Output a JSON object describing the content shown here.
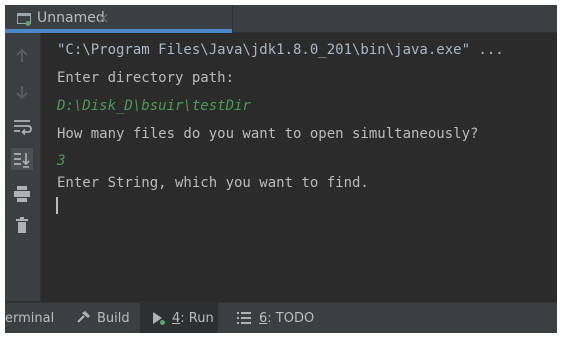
{
  "tab": {
    "title": "Unnamed",
    "close": "×",
    "icon": "run-console-icon"
  },
  "toolbar": {
    "buttons": [
      {
        "name": "up-arrow-icon"
      },
      {
        "name": "down-arrow-icon"
      },
      {
        "name": "soft-wrap-icon"
      },
      {
        "name": "scroll-to-end-icon"
      },
      {
        "name": "print-icon"
      },
      {
        "name": "trash-icon"
      }
    ]
  },
  "console": {
    "lines": [
      "\"C:\\Program Files\\Java\\jdk1.8.0_201\\bin\\java.exe\" ...",
      "Enter directory path:",
      "D:\\Disk_D\\bsuir\\testDir",
      "How many files do you want to open simultaneously?",
      "3",
      "Enter String, which you want to find."
    ]
  },
  "bottom_tabs": {
    "terminal": "erminal",
    "build": "Build",
    "run_prefix": "4",
    "run_suffix": ": Run",
    "todo_prefix": "6",
    "todo_suffix": ": TODO"
  },
  "colors": {
    "accent": "#4a88c7",
    "input_text": "#499c54",
    "console_text": "#bbbbbb"
  }
}
